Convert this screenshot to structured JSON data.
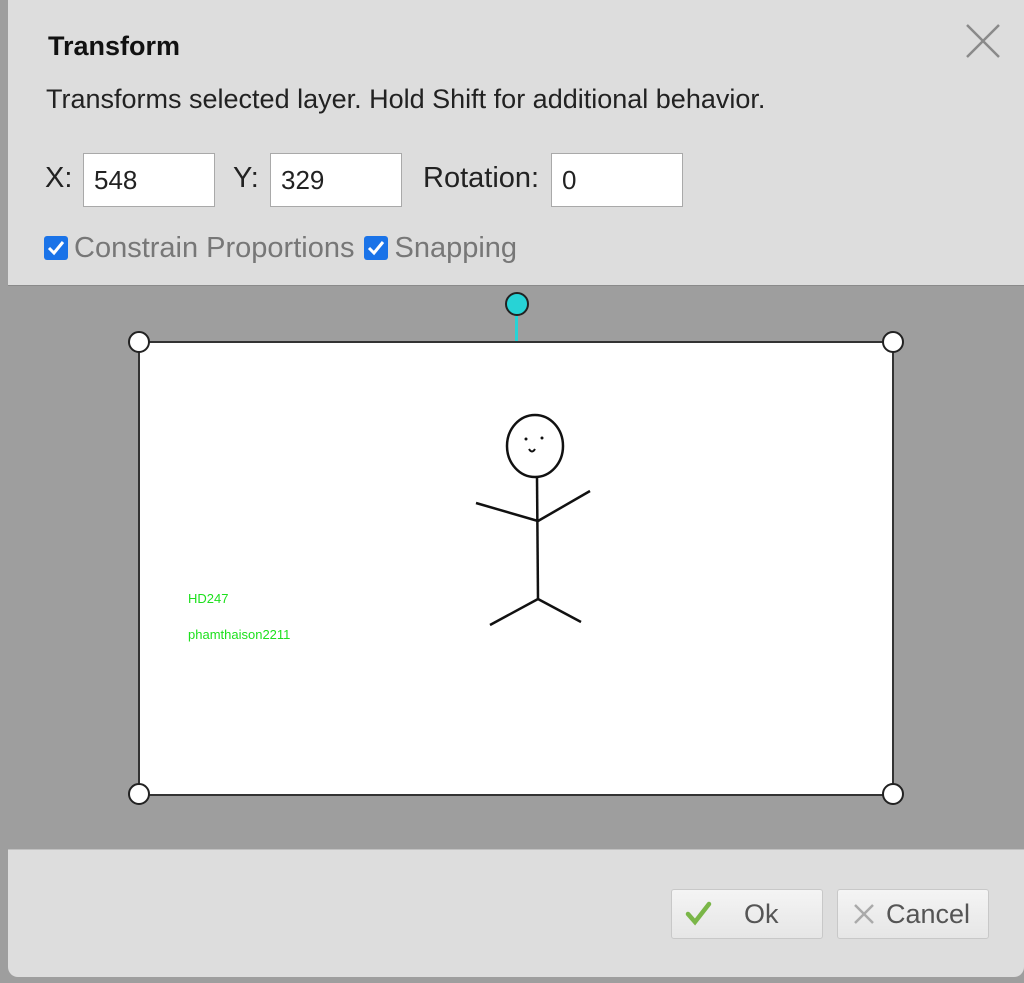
{
  "dialog": {
    "title": "Transform",
    "description": "Transforms selected layer. Hold Shift for additional behavior."
  },
  "fields": {
    "x_label": "X:",
    "x_value": "548",
    "y_label": "Y:",
    "y_value": "329",
    "rotation_label": "Rotation:",
    "rotation_value": "0"
  },
  "options": {
    "constrain_label": "Constrain Proportions",
    "constrain_checked": true,
    "snapping_label": "Snapping",
    "snapping_checked": true
  },
  "layer_content": {
    "text1": "HD247",
    "text2": "phamthaison2211",
    "text_color": "#1de01d"
  },
  "buttons": {
    "ok_label": "Ok",
    "cancel_label": "Cancel"
  },
  "colors": {
    "rotation_handle": "#27d3d6",
    "checkbox": "#1a73e8",
    "ok_check": "#7ab648"
  },
  "icons": {
    "close": "close-icon",
    "ok": "check-icon",
    "cancel": "x-icon"
  }
}
